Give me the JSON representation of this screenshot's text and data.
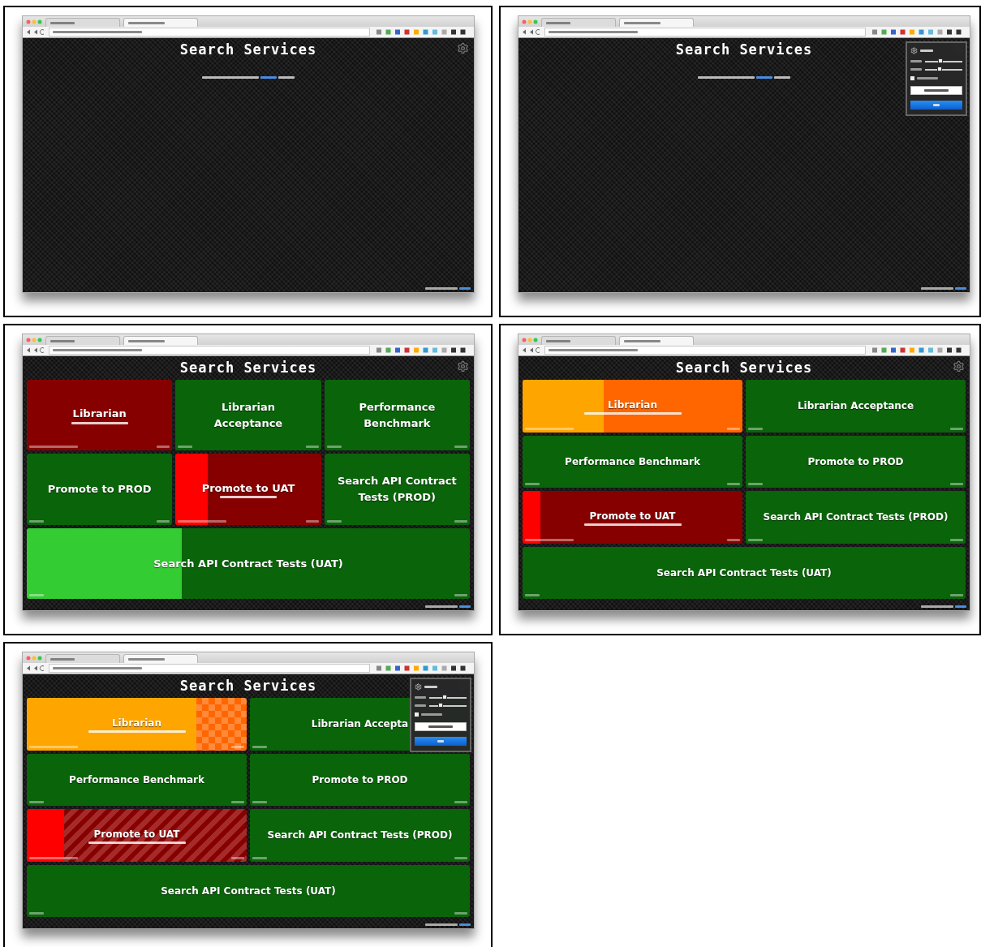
{
  "panels": [
    {
      "title": "Search Services",
      "kind": "three-col",
      "settings_open": false,
      "empty_notice": true
    },
    {
      "title": "Search Services",
      "kind": "three-col",
      "settings_open": true,
      "empty_notice": true,
      "settings": {
        "sliders": [
          {
            "level": 0.42
          },
          {
            "level": 0.4
          }
        ],
        "checkbox": {
          "checked": true
        }
      }
    },
    {
      "title": "Search Services",
      "kind": "three-col",
      "settings_open": false,
      "empty_notice": false,
      "tiles": [
        {
          "name": "Librarian",
          "kind": "failed",
          "subtitle": true,
          "wide": false
        },
        {
          "name": "Librarian Acceptance",
          "kind": "passed",
          "subtitle": false,
          "wide": false
        },
        {
          "name": "Performance Benchmark",
          "kind": "passed",
          "subtitle": false,
          "wide": false
        },
        {
          "name": "Promote to PROD",
          "kind": "passed",
          "subtitle": false,
          "wide": false
        },
        {
          "name": "Promote to UAT",
          "kind": "failed",
          "subtitle": true,
          "wide": false,
          "progress": {
            "level": 0.22,
            "kind": "plain"
          }
        },
        {
          "name": "Search API Contract Tests (PROD)",
          "kind": "passed",
          "subtitle": false,
          "wide": false
        },
        {
          "name": "Search API Contract Tests (UAT)",
          "kind": "passed",
          "subtitle": false,
          "wide": true,
          "progress": {
            "level": 0.35,
            "kind": "plain"
          }
        }
      ]
    },
    {
      "title": "Search Services",
      "kind": "two-col",
      "settings_open": false,
      "empty_notice": false,
      "tiles": [
        {
          "name": "Librarian",
          "kind": "unstable",
          "subtitle": true,
          "wide": false,
          "progress": {
            "level": 0.37,
            "kind": "plain"
          }
        },
        {
          "name": "Librarian Acceptance",
          "kind": "passed",
          "subtitle": false,
          "wide": false
        },
        {
          "name": "Performance Benchmark",
          "kind": "passed",
          "subtitle": false,
          "wide": false
        },
        {
          "name": "Promote to PROD",
          "kind": "passed",
          "subtitle": false,
          "wide": false
        },
        {
          "name": "Promote to UAT",
          "kind": "failed",
          "subtitle": true,
          "wide": false,
          "progress": {
            "level": 0.08,
            "kind": "plain"
          }
        },
        {
          "name": "Search API Contract Tests (PROD)",
          "kind": "passed",
          "subtitle": false,
          "wide": false
        },
        {
          "name": "Search API Contract Tests (UAT)",
          "kind": "passed",
          "subtitle": false,
          "wide": true
        }
      ]
    },
    {
      "title": "Search Services",
      "kind": "two-col",
      "settings_open": true,
      "empty_notice": false,
      "settings": {
        "sliders": [
          {
            "level": 0.42
          },
          {
            "level": 0.3
          }
        ],
        "checkbox": {
          "checked": true
        }
      },
      "tiles": [
        {
          "name": "Librarian",
          "kind": "unstable",
          "subtitle": true,
          "wide": false,
          "progress": {
            "level": 0.77,
            "kind": "checker"
          }
        },
        {
          "name": "Librarian Accepta",
          "kind": "passed",
          "subtitle": false,
          "wide": false
        },
        {
          "name": "Performance Benchmark",
          "kind": "passed",
          "subtitle": false,
          "wide": false
        },
        {
          "name": "Promote to PROD",
          "kind": "passed",
          "subtitle": false,
          "wide": false
        },
        {
          "name": "Promote to UAT",
          "kind": "failed",
          "subtitle": true,
          "wide": false,
          "progress": {
            "level": 0.17,
            "kind": "stripes"
          }
        },
        {
          "name": "Search API Contract Tests (PROD)",
          "kind": "passed",
          "subtitle": false,
          "wide": false
        },
        {
          "name": "Search API Contract Tests (UAT)",
          "kind": "passed",
          "subtitle": false,
          "wide": true
        }
      ]
    }
  ]
}
